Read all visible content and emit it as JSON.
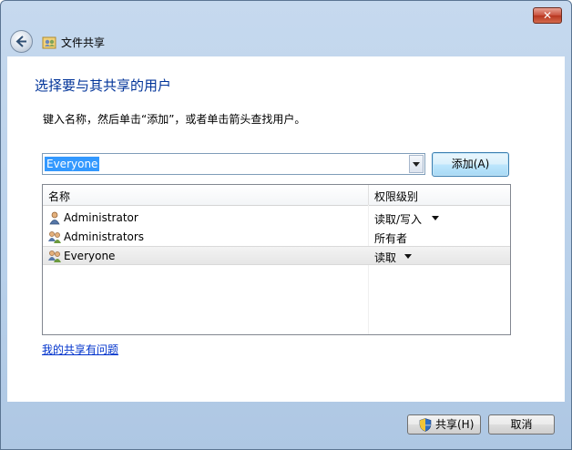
{
  "window": {
    "title": "文件共享",
    "close_label": "✕"
  },
  "instruction": "选择要与其共享的用户",
  "hint": "键入名称，然后单击“添加”，或者单击箭头查找用户。",
  "user_input": {
    "value": "Everyone"
  },
  "add_button": "添加(A)",
  "table": {
    "columns": [
      "名称",
      "权限级别"
    ],
    "rows": [
      {
        "name": "Administrator",
        "permission": "读取/写入",
        "has_dropdown": true,
        "icon": "user-icon"
      },
      {
        "name": "Administrators",
        "permission": "所有者",
        "has_dropdown": false,
        "icon": "group-icon"
      },
      {
        "name": "Everyone",
        "permission": "读取",
        "has_dropdown": true,
        "icon": "group-icon",
        "selected": true
      }
    ]
  },
  "help_link": "我的共享有问题",
  "buttons": {
    "share": "共享(H)",
    "cancel": "取消"
  },
  "colors": {
    "instruction": "#003399",
    "selection": "#3399ff",
    "link": "#0033cc"
  }
}
